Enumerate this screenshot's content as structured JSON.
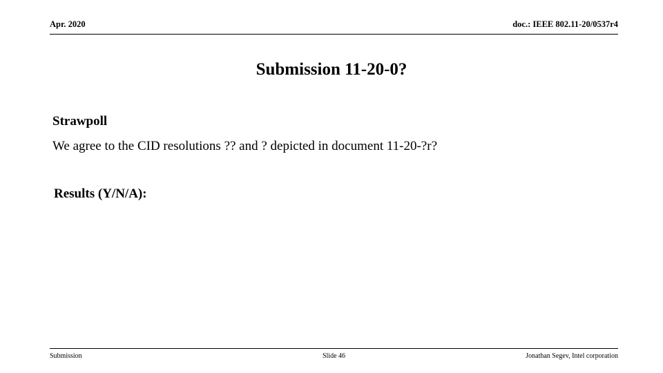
{
  "slide": {
    "background_color": "#ffffff",
    "text_color": "#000000"
  },
  "header": {
    "date": "Apr. 2020",
    "doc_reference": "doc.: IEEE 802.11-20/0537r4"
  },
  "title": "Submission 11-20-0?",
  "body": {
    "strawpoll_heading": "Strawpoll",
    "strawpoll_statement": "We agree to the CID resolutions ?? and ? depicted in document 11-20-?r?",
    "results_label": "Results (Y/N/A):"
  },
  "footer": {
    "left": "Submission",
    "center": "Slide 46",
    "right": "Jonathan Segev, Intel corporation"
  }
}
